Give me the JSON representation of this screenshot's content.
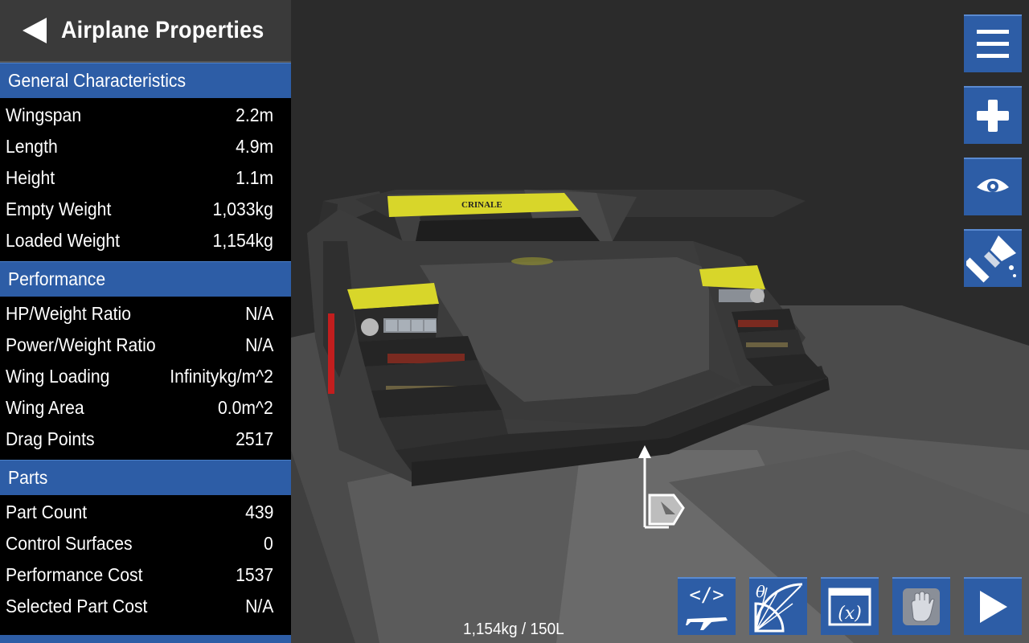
{
  "header": {
    "title": "Airplane Properties"
  },
  "sections": {
    "general": {
      "title": "General Characteristics",
      "rows": [
        {
          "label": "Wingspan",
          "value": "2.2m"
        },
        {
          "label": "Length",
          "value": "4.9m"
        },
        {
          "label": "Height",
          "value": "1.1m"
        },
        {
          "label": "Empty Weight",
          "value": "1,033kg"
        },
        {
          "label": "Loaded Weight",
          "value": "1,154kg"
        }
      ]
    },
    "performance": {
      "title": "Performance",
      "rows": [
        {
          "label": "HP/Weight Ratio",
          "value": "N/A"
        },
        {
          "label": "Power/Weight Ratio",
          "value": "N/A"
        },
        {
          "label": "Wing Loading",
          "value": "Infinitykg/m^2"
        },
        {
          "label": "Wing Area",
          "value": "0.0m^2"
        },
        {
          "label": "Drag Points",
          "value": "2517"
        }
      ]
    },
    "parts": {
      "title": "Parts",
      "rows": [
        {
          "label": "Part Count",
          "value": "439"
        },
        {
          "label": "Control Surfaces",
          "value": "0"
        },
        {
          "label": "Performance Cost",
          "value": "1537"
        },
        {
          "label": "Selected Part Cost",
          "value": "N/A"
        }
      ]
    }
  },
  "viewport": {
    "decal_text": "CRINALE"
  },
  "status": {
    "weight_fuel": "1,154kg / 150L"
  },
  "toolbar": {
    "right": [
      "menu-icon",
      "add-part-icon",
      "visibility-eye-icon",
      "paint-brush-icon"
    ],
    "bottom": [
      "xml-airplane-icon",
      "rotation-angle-icon",
      "variables-icon",
      "hand-grab-icon",
      "play-icon"
    ]
  },
  "colors": {
    "accent_blue": "#2d5da6",
    "panel_black": "#000000",
    "header_gray": "#3a3a3a",
    "decal_yellow": "#d8d62a"
  }
}
